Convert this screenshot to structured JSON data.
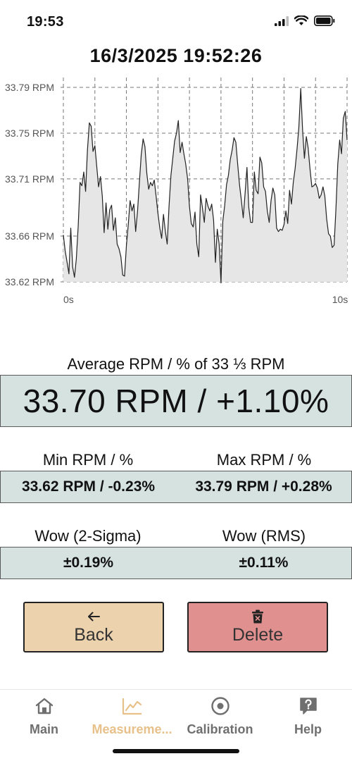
{
  "status_bar": {
    "time": "19:53"
  },
  "header": {
    "timestamp": "16/3/2025 19:52:26"
  },
  "chart_data": {
    "type": "area",
    "y_tick_labels": [
      "33.79 RPM",
      "33.75 RPM",
      "33.71 RPM",
      "33.66 RPM",
      "33.62 RPM"
    ],
    "y_ticks": [
      33.79,
      33.75,
      33.71,
      33.66,
      33.62
    ],
    "x_tick_labels": [
      "0s",
      "10s"
    ],
    "xlim": [
      0,
      10
    ],
    "ylim": [
      33.62,
      33.79
    ],
    "grid": true,
    "series": [
      {
        "values": [
          33.661,
          33.647,
          33.637,
          33.627,
          33.667,
          33.633,
          33.624,
          33.64,
          33.669,
          33.707,
          33.704,
          33.716,
          33.699,
          33.735,
          33.759,
          33.756,
          33.734,
          33.739,
          33.721,
          33.703,
          33.712,
          33.695,
          33.663,
          33.689,
          33.666,
          33.683,
          33.687,
          33.665,
          33.676,
          33.653,
          33.649,
          33.642,
          33.626,
          33.625,
          33.652,
          33.67,
          33.691,
          33.682,
          33.688,
          33.664,
          33.682,
          33.707,
          33.731,
          33.745,
          33.738,
          33.715,
          33.701,
          33.707,
          33.704,
          33.709,
          33.695,
          33.68,
          33.667,
          33.658,
          33.679,
          33.664,
          33.653,
          33.686,
          33.713,
          33.728,
          33.743,
          33.75,
          33.761,
          33.733,
          33.742,
          33.732,
          33.723,
          33.71,
          33.686,
          33.671,
          33.668,
          33.681,
          33.653,
          33.642,
          33.696,
          33.685,
          33.672,
          33.693,
          33.686,
          33.682,
          33.688,
          33.674,
          33.637,
          33.666,
          33.653,
          33.619,
          33.673,
          33.687,
          33.705,
          33.713,
          33.727,
          33.735,
          33.746,
          33.742,
          33.723,
          33.705,
          33.691,
          33.676,
          33.697,
          33.72,
          33.685,
          33.672,
          33.672,
          33.716,
          33.7,
          33.697,
          33.729,
          33.724,
          33.703,
          33.699,
          33.682,
          33.672,
          33.691,
          33.702,
          33.696,
          33.667,
          33.664,
          33.666,
          33.665,
          33.67,
          33.682,
          33.671,
          33.7,
          33.688,
          33.707,
          33.719,
          33.736,
          33.755,
          33.789,
          33.753,
          33.728,
          33.747,
          33.737,
          33.719,
          33.703,
          33.704,
          33.706,
          33.702,
          33.693,
          33.696,
          33.703,
          33.695,
          33.675,
          33.662,
          33.66,
          33.65,
          33.652,
          33.684,
          33.723,
          33.744,
          33.732,
          33.763,
          33.769,
          33.744
        ]
      }
    ]
  },
  "average": {
    "label": "Average RPM / % of 33 ⅓ RPM",
    "value": "33.70 RPM / +1.10%"
  },
  "min_max": {
    "min_label": "Min RPM / %",
    "max_label": "Max RPM / %",
    "min_value": "33.62 RPM / -0.23%",
    "max_value": "33.79 RPM / +0.28%"
  },
  "wow": {
    "sigma_label": "Wow (2-Sigma)",
    "rms_label": "Wow (RMS)",
    "sigma_value": "±0.19%",
    "rms_value": "±0.11%"
  },
  "buttons": {
    "back_label": "Back",
    "back_icon": "arrow-left-icon",
    "delete_label": "Delete",
    "delete_icon": "trash-icon"
  },
  "tabs": [
    {
      "label": "Main",
      "icon": "home-icon",
      "active": false
    },
    {
      "label": "Measureme...",
      "icon": "chart-line-icon",
      "active": true
    },
    {
      "label": "Calibration",
      "icon": "target-icon",
      "active": false
    },
    {
      "label": "Help",
      "icon": "help-icon",
      "active": false
    }
  ],
  "colors": {
    "value_box_bg": "#d5e2df",
    "back_button_bg": "#ecd3ad",
    "delete_button_bg": "#e19090",
    "active_tab": "#e7c189",
    "inactive_tab": "#6f6f6f",
    "chart_fill": "#e6e6e6",
    "chart_line": "#222222"
  }
}
